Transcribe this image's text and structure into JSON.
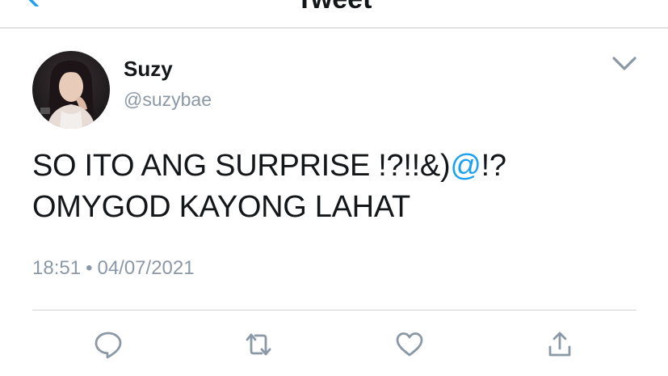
{
  "nav": {
    "title": "Tweet",
    "back_icon": "chevron-left-icon"
  },
  "author": {
    "name": "Suzy",
    "handle": "@suzybae",
    "avatar_icon": "avatar"
  },
  "tweet": {
    "line1_before": "SO ITO ANG SURPRISE !?!!&)",
    "mention": "@",
    "line1_after": "!?",
    "line2": "OMYGOD KAYONG LAHAT"
  },
  "meta": {
    "time": "18:51",
    "separator": "•",
    "date": "04/07/2021"
  },
  "actions": [
    "reply-icon",
    "retweet-icon",
    "like-icon",
    "share-icon"
  ],
  "colors": {
    "accent": "#1da1f2",
    "secondary_text": "#8b98a5",
    "primary_text": "#14171a",
    "divider": "#d0d3d6"
  }
}
